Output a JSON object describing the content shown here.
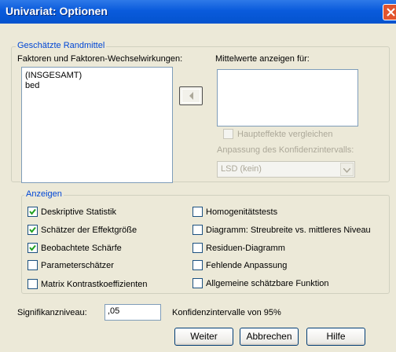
{
  "window": {
    "title": "Univariat: Optionen"
  },
  "randmittel": {
    "legend": "Geschätzte Randmittel",
    "factors_label": "Faktoren und Faktoren-Wechselwirkungen:",
    "factors": [
      "(INSGESAMT)",
      "bed"
    ],
    "means_label": "Mittelwerte anzeigen für:",
    "compare_label": "Haupteffekte vergleichen",
    "ci_adjust_label": "Anpassung des Konfidenzintervalls:",
    "ci_adjust_value": "LSD (kein)"
  },
  "anzeigen": {
    "legend": "Anzeigen",
    "left": [
      {
        "label": "Deskriptive Statistik",
        "checked": true
      },
      {
        "label": "Schätzer der Effektgröße",
        "checked": true
      },
      {
        "label": "Beobachtete Schärfe",
        "checked": true
      },
      {
        "label": "Parameterschätzer",
        "checked": false
      },
      {
        "label": "Matrix Kontrastkoeffizienten",
        "checked": false
      }
    ],
    "right": [
      {
        "label": "Homogenitätstests",
        "checked": false
      },
      {
        "label": "Diagramm: Streubreite vs. mittleres Niveau",
        "checked": false
      },
      {
        "label": "Residuen-Diagramm",
        "checked": false
      },
      {
        "label": "Fehlende Anpassung",
        "checked": false
      },
      {
        "label": "Allgemeine schätzbare Funktion",
        "checked": false
      }
    ]
  },
  "signif": {
    "label": "Signifikanzniveau:",
    "value": ",05",
    "ci_text": "Konfidenzintervalle von 95%"
  },
  "buttons": {
    "weiter": "Weiter",
    "abbrechen": "Abbrechen",
    "hilfe": "Hilfe"
  }
}
